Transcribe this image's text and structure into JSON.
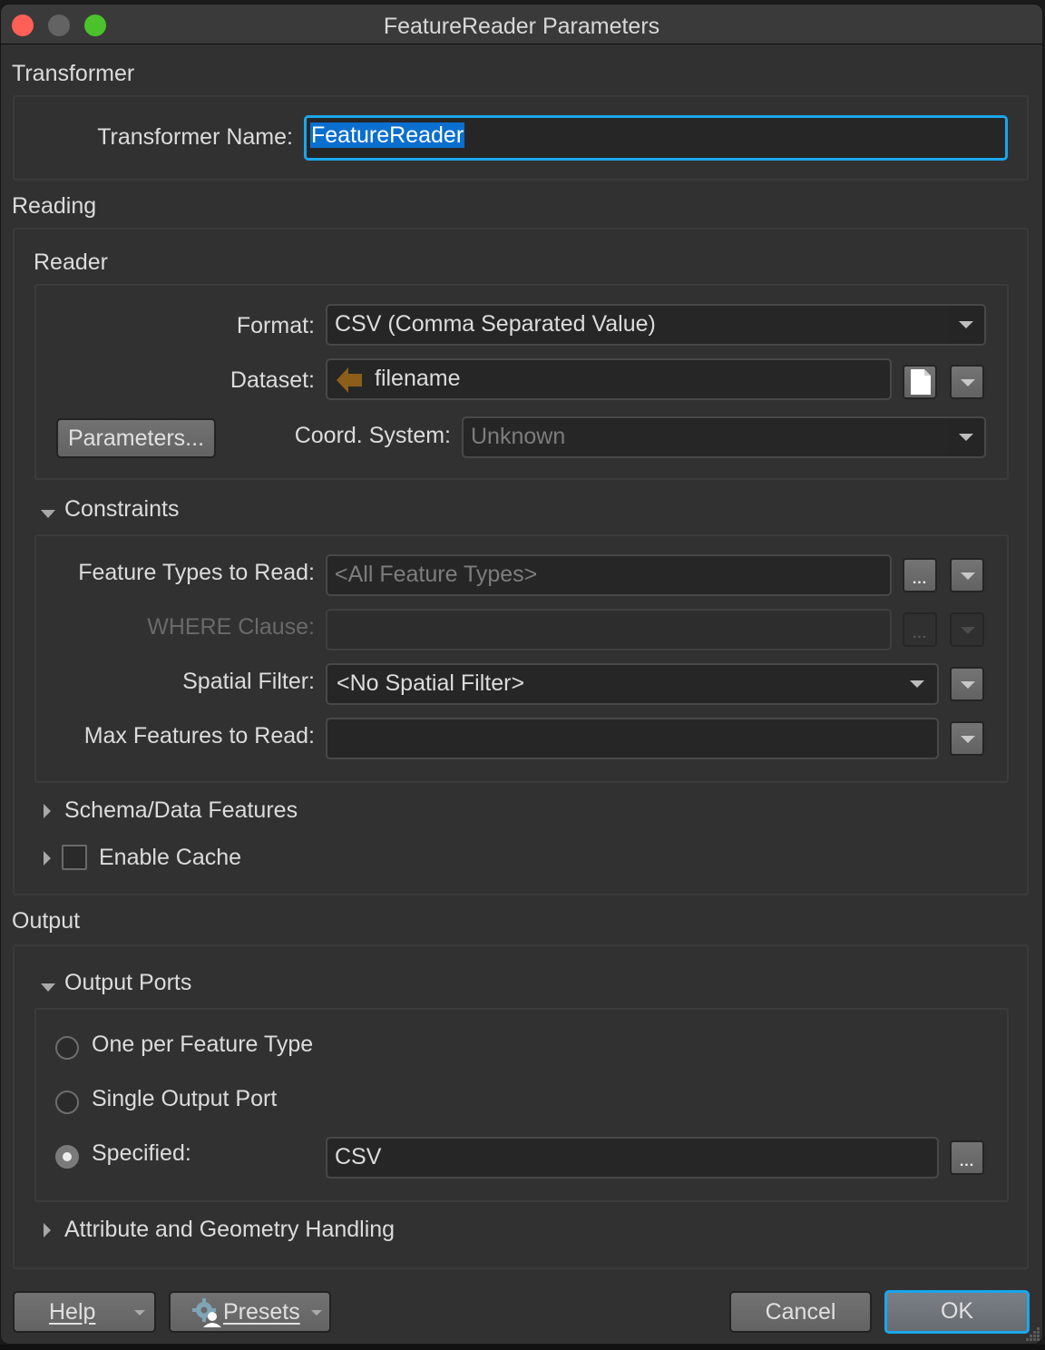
{
  "window": {
    "title": "FeatureReader Parameters"
  },
  "transformer": {
    "section_label": "Transformer",
    "name_label": "Transformer Name:",
    "name_value": "FeatureReader"
  },
  "reading": {
    "section_label": "Reading",
    "reader": {
      "group_label": "Reader",
      "format_label": "Format:",
      "format_value": "CSV (Comma Separated Value)",
      "dataset_label": "Dataset:",
      "dataset_value": "filename",
      "parameters_button": "Parameters...",
      "coord_label": "Coord. System:",
      "coord_value": "Unknown"
    },
    "constraints": {
      "label": "Constraints",
      "expanded": true,
      "feature_types_label": "Feature Types to Read:",
      "feature_types_placeholder": "<All Feature Types>",
      "where_label": "WHERE Clause:",
      "where_value": "",
      "spatial_filter_label": "Spatial Filter:",
      "spatial_filter_value": "<No Spatial Filter>",
      "max_features_label": "Max Features to Read:",
      "max_features_value": ""
    },
    "schema_label": "Schema/Data Features",
    "enable_cache_label": "Enable Cache",
    "enable_cache_checked": false
  },
  "output": {
    "section_label": "Output",
    "ports": {
      "label": "Output Ports",
      "expanded": true,
      "options": [
        {
          "label": "One per Feature Type",
          "checked": false
        },
        {
          "label": "Single Output Port",
          "checked": false
        },
        {
          "label": "Specified:",
          "checked": true
        }
      ],
      "specified_value": "CSV"
    },
    "attr_geom_label": "Attribute and Geometry Handling"
  },
  "footer": {
    "help": "Help",
    "presets": "Presets",
    "cancel": "Cancel",
    "ok": "OK"
  },
  "icons": {
    "dots": "..."
  },
  "colors": {
    "accent": "#1aa7ec",
    "selection": "#0a6fcf",
    "dataset_arrow": "#8b5e1a"
  }
}
